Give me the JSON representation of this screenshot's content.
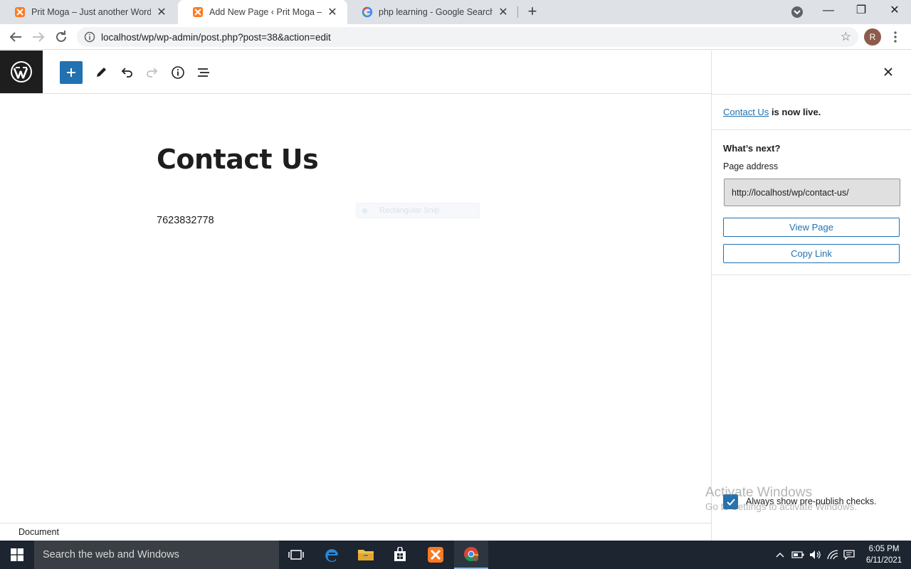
{
  "browser": {
    "tabs": [
      {
        "title": "Prit Moga – Just another WordPress site",
        "active": false
      },
      {
        "title": "Add New Page ‹ Prit Moga — WordPress",
        "active": true
      },
      {
        "title": "php learning - Google Search",
        "active": false
      }
    ],
    "url": "localhost/wp/wp-admin/post.php?post=38&action=edit",
    "profile_initial": "R"
  },
  "editor": {
    "title": "Contact Us",
    "paragraph": "7623832778",
    "snip_overlay": "Rectangular Snip",
    "breadcrumb": "Document"
  },
  "sidebar": {
    "live_link": "Contact Us",
    "live_suffix": "is now live.",
    "whats_next": "What’s next?",
    "page_address_label": "Page address",
    "page_address": "http://localhost/wp/contact-us/",
    "view_page": "View Page",
    "copy_link": "Copy Link",
    "prepublish_checks": "Always show pre-publish checks.",
    "prepublish_checked": true
  },
  "watermark": {
    "line1": "Activate Windows",
    "line2": "Go to Settings to activate Windows."
  },
  "taskbar": {
    "search_placeholder": "Search the web and Windows",
    "time": "6:05 PM",
    "date": "6/11/2021"
  },
  "colors": {
    "accent": "#2271b1",
    "wp_dark": "#1e1e1e",
    "taskbar": "#1c2530"
  }
}
